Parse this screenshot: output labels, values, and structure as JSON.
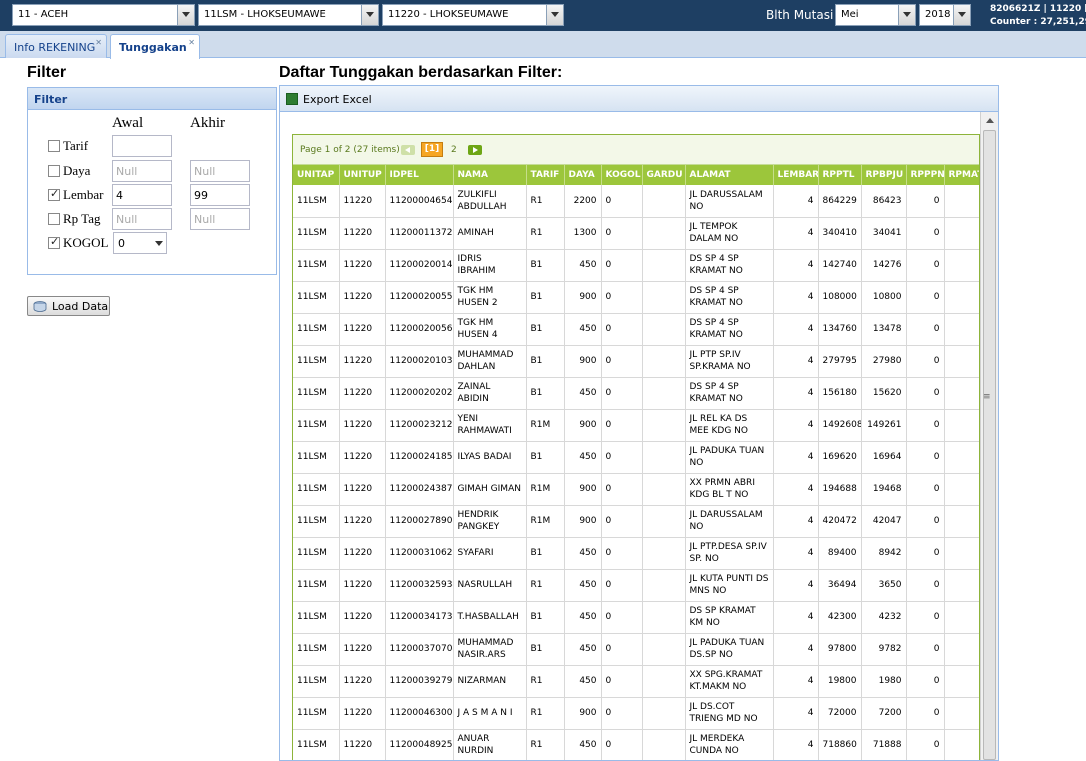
{
  "topbar": {
    "wilayah": "11 - ACEH",
    "area": "11LSM - LHOKSEUMAWE",
    "unit": "11220 - LHOKSEUMAWE",
    "blth_label": "Blth Mutasi :",
    "bulan": "Mei",
    "tahun": "2018",
    "user_line1": "8206621Z | 11220 [UP",
    "user_line2": "Counter : 27,251,29"
  },
  "tabs": [
    {
      "label": "Info REKENING"
    },
    {
      "label": "Tunggakan"
    }
  ],
  "filter": {
    "heading": "Filter",
    "panel_title": "Filter",
    "col_awal": "Awal",
    "col_akhir": "Akhir",
    "rows": [
      {
        "label": "Tarif",
        "checked": false,
        "awal": "",
        "akhir": ""
      },
      {
        "label": "Daya",
        "checked": false,
        "awal": "Null",
        "akhir": "Null"
      },
      {
        "label": "Lembar",
        "checked": true,
        "awal": "4",
        "akhir": "99"
      },
      {
        "label": "Rp Tag",
        "checked": false,
        "awal": "Null",
        "akhir": "Null"
      },
      {
        "label": "KOGOL",
        "checked": true,
        "awal": "0",
        "akhir": ""
      }
    ],
    "load_button": "Load Data"
  },
  "list": {
    "heading": "Daftar Tunggakan berdasarkan Filter:",
    "export_label": "Export Excel",
    "pager": {
      "info": "Page 1 of 2 (27 items)",
      "current": "[1]",
      "page2": "2"
    },
    "columns": [
      "UNITAP",
      "UNITUP",
      "IDPEL",
      "NAMA",
      "TARIF",
      "DAYA",
      "KOGOL",
      "GARDU",
      "ALAMAT",
      "LEMBAR",
      "RPPTL",
      "RPBPJU",
      "RPPPN",
      "RPMAT"
    ],
    "rows": [
      [
        "11LSM",
        "11220",
        "112000046541",
        "ZULKIFLI ABDULLAH",
        "R1",
        "2200",
        "0",
        "",
        "JL DARUSSALAM NO",
        "4",
        "864229",
        "86423",
        "0",
        "3000"
      ],
      [
        "11LSM",
        "11220",
        "112000113720",
        "AMINAH",
        "R1",
        "1300",
        "0",
        "",
        "JL TEMPOK DALAM NO",
        "4",
        "340410",
        "34041",
        "0",
        "0"
      ],
      [
        "11LSM",
        "11220",
        "112000200143",
        "IDRIS IBRAHIM",
        "B1",
        "450",
        "0",
        "",
        "DS SP 4 SP KRAMAT NO",
        "4",
        "142740",
        "14276",
        "0",
        "0"
      ],
      [
        "11LSM",
        "11220",
        "112000200557",
        "TGK HM HUSEN 2",
        "B1",
        "900",
        "0",
        "",
        "DS SP 4 SP KRAMAT NO",
        "4",
        "108000",
        "10800",
        "0",
        "0"
      ],
      [
        "11LSM",
        "11220",
        "112000200569",
        "TGK HM HUSEN 4",
        "B1",
        "450",
        "0",
        "",
        "DS SP 4 SP KRAMAT NO",
        "4",
        "134760",
        "13478",
        "0",
        "0"
      ],
      [
        "11LSM",
        "11220",
        "112000201030",
        "MUHAMMAD DAHLAN",
        "B1",
        "900",
        "0",
        "",
        "JL PTP SP.IV SP.KRAMA NO",
        "4",
        "279795",
        "27980",
        "0",
        "0"
      ],
      [
        "11LSM",
        "11220",
        "112000202025",
        "ZAINAL ABIDIN",
        "B1",
        "450",
        "0",
        "",
        "DS SP 4 SP KRAMAT NO",
        "4",
        "156180",
        "15620",
        "0",
        "0"
      ],
      [
        "11LSM",
        "11220",
        "112000232120",
        "YENI RAHMAWATI",
        "R1M",
        "900",
        "0",
        "",
        "JL REL KA DS MEE KDG NO",
        "4",
        "1492608",
        "149261",
        "0",
        "3000"
      ],
      [
        "11LSM",
        "11220",
        "112000241851",
        "ILYAS BADAI",
        "B1",
        "450",
        "0",
        "",
        "JL PADUKA TUAN NO",
        "4",
        "169620",
        "16964",
        "0",
        "0"
      ],
      [
        "11LSM",
        "11220",
        "112000243879",
        "GIMAH GIMAN",
        "R1M",
        "900",
        "0",
        "",
        "XX PRMN ABRI KDG BL T NO",
        "4",
        "194688",
        "19468",
        "0",
        "0"
      ],
      [
        "11LSM",
        "11220",
        "112000278900",
        "HENDRIK PANGKEY",
        "R1M",
        "900",
        "0",
        "",
        "JL DARUSSALAM NO",
        "4",
        "420472",
        "42047",
        "0",
        "0"
      ],
      [
        "11LSM",
        "11220",
        "112000310628",
        "SYAFARI",
        "B1",
        "450",
        "0",
        "",
        "JL PTP.DESA SP.IV SP. NO",
        "4",
        "89400",
        "8942",
        "0",
        "0"
      ],
      [
        "11LSM",
        "11220",
        "112000325934",
        "NASRULLAH",
        "R1",
        "450",
        "0",
        "",
        "JL KUTA PUNTI DS MNS NO",
        "4",
        "36494",
        "3650",
        "0",
        "0"
      ],
      [
        "11LSM",
        "11220",
        "112000341732",
        "T.HASBALLAH",
        "B1",
        "450",
        "0",
        "",
        "DS SP KRAMAT KM NO",
        "4",
        "42300",
        "4232",
        "0",
        "0"
      ],
      [
        "11LSM",
        "11220",
        "112000370704",
        "MUHAMMAD NASIR.ARS",
        "B1",
        "450",
        "0",
        "",
        "JL PADUKA TUAN DS.SP NO",
        "4",
        "97800",
        "9782",
        "0",
        "0"
      ],
      [
        "11LSM",
        "11220",
        "112000392791",
        "NIZARMAN",
        "R1",
        "450",
        "0",
        "",
        "XX SPG.KRAMAT KT.MAKM NO",
        "4",
        "19800",
        "1980",
        "0",
        "0"
      ],
      [
        "11LSM",
        "11220",
        "112000463008",
        "J A S M A N I",
        "R1",
        "900",
        "0",
        "",
        "JL DS.COT TRIENG MD NO",
        "4",
        "72000",
        "7200",
        "0",
        "0"
      ],
      [
        "11LSM",
        "11220",
        "112000489257",
        "ANUAR NURDIN",
        "R1",
        "450",
        "0",
        "",
        "JL MERDEKA CUNDA NO",
        "4",
        "718860",
        "71888",
        "0",
        "0"
      ]
    ]
  },
  "colors": {
    "topbar": "#1e3f63",
    "grid_header": "#9cc63b",
    "panel_border": "#99bbe8"
  }
}
